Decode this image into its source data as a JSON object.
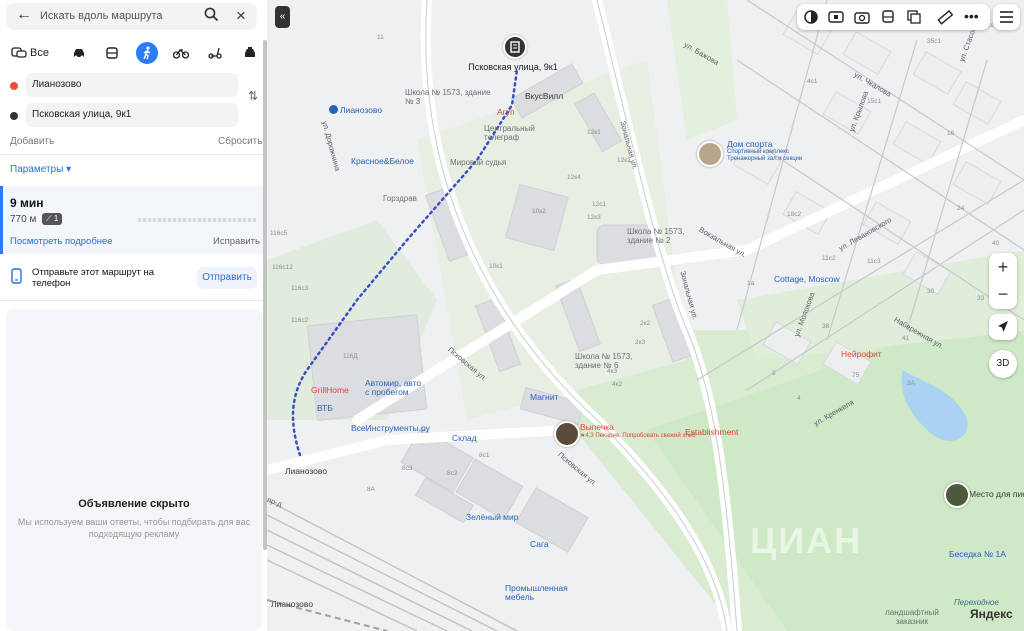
{
  "search": {
    "placeholder": "Искать вдоль маршрута"
  },
  "modes": [
    {
      "label": "Все",
      "icon": "all-transport-icon"
    },
    {
      "icon": "car-icon"
    },
    {
      "icon": "bus-icon"
    },
    {
      "icon": "pedestrian-icon",
      "active": true
    },
    {
      "icon": "bicycle-icon"
    },
    {
      "icon": "scooter-icon"
    },
    {
      "icon": "taxi-icon"
    }
  ],
  "route": {
    "from": "Лианозово",
    "to": "Псковская улица, 9к1",
    "from_color": "#e8503a",
    "to_color": "#333333",
    "add_label": "Добавить",
    "reset_label": "Сбросить",
    "params_label": "Параметры ▾"
  },
  "result": {
    "time": "9 мин",
    "distance": "770 м",
    "crossings": "1",
    "details_label": "Посмотреть подробнее",
    "fix_label": "Исправить"
  },
  "send": {
    "text": "Отправьте этот маршрут на телефон",
    "button": "Отправить"
  },
  "ad": {
    "title": "Объявление скрыто",
    "text": "Мы используем ваши ответы, чтобы подбирать для вас подходящую рекламу"
  },
  "map": {
    "destination": "Псковская улица, 9к1",
    "accent": "#2b7cf6",
    "route_color": "#3a4fc4",
    "streets": [
      "ул. Дорожнина",
      "Псковская ул.",
      "Псковская ул.",
      "Зональная ул.",
      "Зональная ул.",
      "Вокзальная ул.",
      "ул. Молокова",
      "ул. Чкалова",
      "ул. Бажова",
      "ул. Крылова",
      "ул. Кренкеля",
      "ул. Левановского",
      "Набережная ул.",
      "ул. Стасова",
      "пр-д"
    ],
    "pois": [
      {
        "name": "Лианозово",
        "kind": "blue"
      },
      {
        "name": "Школа № 1573, здание № 3",
        "kind": "gray"
      },
      {
        "name": "ВкусВилл",
        "kind": "gray"
      },
      {
        "name": "Агуп",
        "kind": "red"
      },
      {
        "name": "Центральный телеграф",
        "kind": "gray"
      },
      {
        "name": "Мировой судья",
        "kind": "gray"
      },
      {
        "name": "Красное&Белое",
        "kind": "blue"
      },
      {
        "name": "Горздрав",
        "kind": "gray"
      },
      {
        "name": "Дом спорта",
        "kind": "blue"
      },
      {
        "name": "Спортивный комплекс Тренажерный зал и секции",
        "kind": "blue"
      },
      {
        "name": "Школа № 1573, здание № 2",
        "kind": "gray"
      },
      {
        "name": "Cottage, Moscow",
        "kind": "blue"
      },
      {
        "name": "Нейрофит",
        "kind": "red"
      },
      {
        "name": "Школа № 1573, здание № 6",
        "kind": "gray"
      },
      {
        "name": "GrillHome",
        "kind": "red"
      },
      {
        "name": "Автомир, авто с пробегом",
        "kind": "blue"
      },
      {
        "name": "ВТБ",
        "kind": "blue"
      },
      {
        "name": "ВсеИнструменты.ру",
        "kind": "blue"
      },
      {
        "name": "Склад",
        "kind": "blue"
      },
      {
        "name": "Магнит",
        "kind": "blue"
      },
      {
        "name": "Выпечка",
        "kind": "red"
      },
      {
        "name": "★4,3 Пекарня. Попробовать свежий хлеб",
        "kind": "red"
      },
      {
        "name": "Establishment",
        "kind": "red"
      },
      {
        "name": "Зелёный мир",
        "kind": "blue"
      },
      {
        "name": "Сага",
        "kind": "blue"
      },
      {
        "name": "Промышленная мебель",
        "kind": "blue"
      },
      {
        "name": "Лианозово",
        "kind": "metro"
      },
      {
        "name": "Лианозово",
        "kind": "metro"
      },
      {
        "name": "Место для пик",
        "kind": "dark"
      },
      {
        "name": "Беседка № 1А",
        "kind": "blue"
      },
      {
        "name": "Переходное",
        "kind": "gray"
      },
      {
        "name": "ландшафтный заказник",
        "kind": "gray"
      }
    ],
    "addresses": [
      "11",
      "12к1",
      "12к2",
      "12к3",
      "12к4",
      "10к2",
      "10к1",
      "12с1",
      "2к2",
      "2к3",
      "4к3",
      "4к2",
      "8с3",
      "8с2",
      "8с1",
      "8А",
      "116Д",
      "116с12",
      "116с5",
      "116с3",
      "116с2",
      "4с1",
      "15с1",
      "18с2",
      "35с1",
      "2с1",
      "3А",
      "75",
      "11с2",
      "11с3",
      "24",
      "40",
      "16",
      "3",
      "4",
      "1а",
      "41",
      "38",
      "33",
      "30"
    ],
    "watermark": "ЦИАН",
    "brand": "Яндекс"
  },
  "controls": {
    "zoom_in": "+",
    "zoom_out": "−",
    "view_3d": "3D",
    "collapse": "«"
  }
}
